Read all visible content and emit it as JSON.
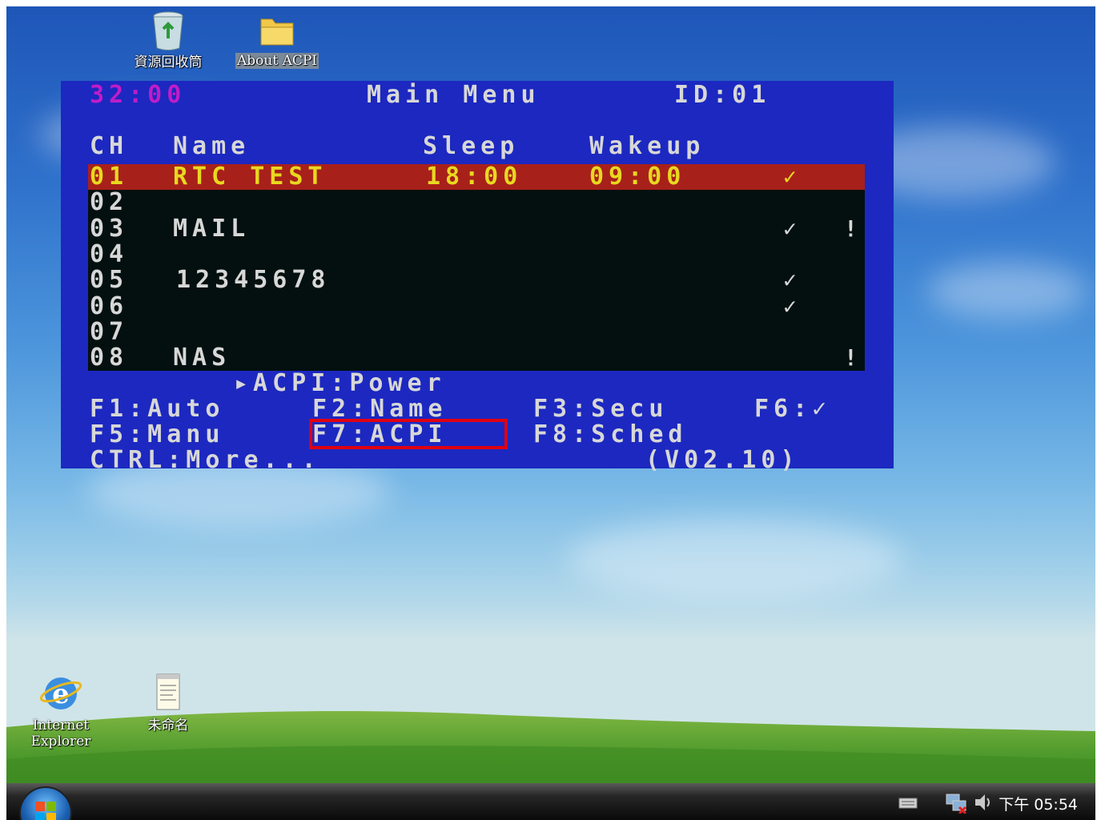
{
  "desktop": {
    "icons": [
      {
        "label": "資源回收筒",
        "icon": "recycle-bin-icon"
      },
      {
        "label": "About ACPI",
        "icon": "folder-icon"
      },
      {
        "label": "Internet\nExplorer",
        "icon": "internet-explorer-icon"
      },
      {
        "label": "未命名",
        "icon": "notepad-document-icon"
      }
    ]
  },
  "osd": {
    "timer": "32:00",
    "title": "Main Menu",
    "id": "ID:01",
    "headers": {
      "ch": "CH",
      "name": "Name",
      "sleep": "Sleep",
      "wakeup": "Wakeup"
    },
    "channels": [
      {
        "ch": "01",
        "name": "RTC TEST",
        "sleep": "18:00",
        "wakeup": "09:00",
        "check": "✓",
        "alert": ""
      },
      {
        "ch": "02",
        "name": "",
        "sleep": "",
        "wakeup": "",
        "check": "",
        "alert": ""
      },
      {
        "ch": "03",
        "name": "MAIL",
        "sleep": "",
        "wakeup": "",
        "check": "✓",
        "alert": "!"
      },
      {
        "ch": "04",
        "name": "",
        "sleep": "",
        "wakeup": "",
        "check": "",
        "alert": ""
      },
      {
        "ch": "05",
        "name": "12345678",
        "sleep": "",
        "wakeup": "",
        "check": "✓",
        "alert": ""
      },
      {
        "ch": "06",
        "name": "",
        "sleep": "",
        "wakeup": "",
        "check": "✓",
        "alert": ""
      },
      {
        "ch": "07",
        "name": "",
        "sleep": "",
        "wakeup": "",
        "check": "",
        "alert": ""
      },
      {
        "ch": "08",
        "name": "NAS",
        "sleep": "",
        "wakeup": "",
        "check": "",
        "alert": "!"
      }
    ],
    "acpi_status": "▸ACPI:Power",
    "keys": {
      "f1": "F1:Auto",
      "f2": "F2:Name",
      "f3": "F3:Secu",
      "f6": "F6:✓",
      "f5": "F5:Manu",
      "f7": "F7:ACPI",
      "f8": "F8:Sched",
      "ctrl": "CTRL:More...",
      "version": "(V02.10)"
    },
    "colors": {
      "bg": "#1c28c0",
      "timer": "#c01cc8",
      "selected_bg": "#a8201a",
      "selected_text": "#e8d820",
      "table_bg": "#03100f",
      "text": "#d7d7d7",
      "highlight_box": "#e00010"
    }
  },
  "taskbar": {
    "clock": "下午 05:54",
    "tray_icons": [
      "keyboard-icon",
      "network-icon",
      "volume-icon"
    ]
  }
}
